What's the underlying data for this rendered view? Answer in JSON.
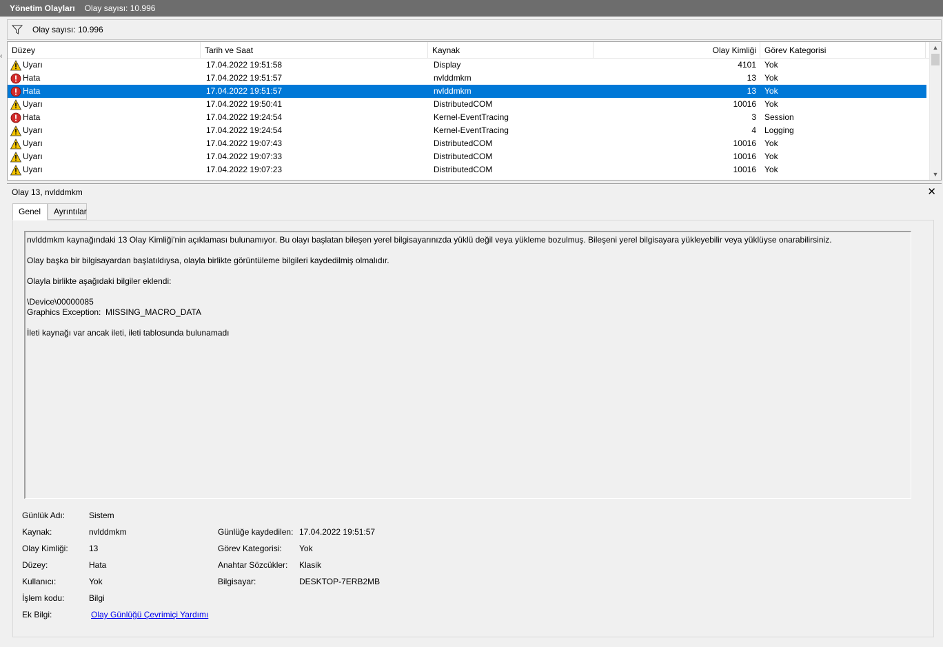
{
  "titlebar": {
    "title": "Yönetim Olayları",
    "count": "Olay sayısı: 10.996"
  },
  "filterbar": {
    "icon": "filter-icon",
    "count": "Olay sayısı: 10.996"
  },
  "columns": {
    "level": "Düzey",
    "date": "Tarih ve Saat",
    "source": "Kaynak",
    "event_id": "Olay Kimliği",
    "category": "Görev Kategorisi"
  },
  "events": [
    {
      "level": "Uyarı",
      "icon": "warning-icon",
      "date": "17.04.2022 19:51:58",
      "source": "Display",
      "id": "4101",
      "category": "Yok"
    },
    {
      "level": "Hata",
      "icon": "error-icon",
      "date": "17.04.2022 19:51:57",
      "source": "nvlddmkm",
      "id": "13",
      "category": "Yok"
    },
    {
      "level": "Hata",
      "icon": "error-icon",
      "date": "17.04.2022 19:51:57",
      "source": "nvlddmkm",
      "id": "13",
      "category": "Yok",
      "selected": true
    },
    {
      "level": "Uyarı",
      "icon": "warning-icon",
      "date": "17.04.2022 19:50:41",
      "source": "DistributedCOM",
      "id": "10016",
      "category": "Yok"
    },
    {
      "level": "Hata",
      "icon": "error-icon",
      "date": "17.04.2022 19:24:54",
      "source": "Kernel-EventTracing",
      "id": "3",
      "category": "Session"
    },
    {
      "level": "Uyarı",
      "icon": "warning-icon",
      "date": "17.04.2022 19:24:54",
      "source": "Kernel-EventTracing",
      "id": "4",
      "category": "Logging"
    },
    {
      "level": "Uyarı",
      "icon": "warning-icon",
      "date": "17.04.2022 19:07:43",
      "source": "DistributedCOM",
      "id": "10016",
      "category": "Yok"
    },
    {
      "level": "Uyarı",
      "icon": "warning-icon",
      "date": "17.04.2022 19:07:33",
      "source": "DistributedCOM",
      "id": "10016",
      "category": "Yok"
    },
    {
      "level": "Uyarı",
      "icon": "warning-icon",
      "date": "17.04.2022 19:07:23",
      "source": "DistributedCOM",
      "id": "10016",
      "category": "Yok"
    }
  ],
  "detail": {
    "header": "Olay 13, nvlddmkm",
    "tabs": {
      "general": "Genel",
      "details": "Ayrıntılar"
    },
    "message": "nvlddmkm kaynağındaki 13 Olay Kimliği'nin açıklaması bulunamıyor. Bu olayı başlatan bileşen yerel bilgisayarınızda yüklü değil veya yükleme bozulmuş. Bileşeni yerel bilgisayara yükleyebilir veya yüklüyse onarabilirsiniz.\n\nOlay başka bir bilgisayardan başlatıldıysa, olayla birlikte görüntüleme bilgileri kaydedilmiş olmalıdır.\n\nOlayla birlikte aşağıdaki bilgiler eklendi:\n\n\\Device\\00000085\nGraphics Exception:  MISSING_MACRO_DATA\n\nİleti kaynağı var ancak ileti, ileti tablosunda bulunamadı",
    "props": {
      "log_name_label": "Günlük Adı:",
      "log_name": "Sistem",
      "source_label": "Kaynak:",
      "source": "nvlddmkm",
      "logged_label": "Günlüğe kaydedilen:",
      "logged": "17.04.2022 19:51:57",
      "event_id_label": "Olay Kimliği:",
      "event_id": "13",
      "category_label": "Görev Kategorisi:",
      "category": "Yok",
      "level_label": "Düzey:",
      "level": "Hata",
      "keywords_label": "Anahtar Sözcükler:",
      "keywords": "Klasik",
      "user_label": "Kullanıcı:",
      "user": "Yok",
      "computer_label": "Bilgisayar:",
      "computer": "DESKTOP-7ERB2MB",
      "opcode_label": "İşlem kodu:",
      "opcode": "Bilgi",
      "more_info_label": "Ek Bilgi:",
      "more_info_link": "Olay Günlüğü Çevrimiçi Yardımı"
    }
  },
  "colors": {
    "selected": "#0078d7",
    "titlebar": "#6d6d6d",
    "warning": "#f5c400",
    "error": "#d22b2b",
    "link": "#0000ee"
  }
}
